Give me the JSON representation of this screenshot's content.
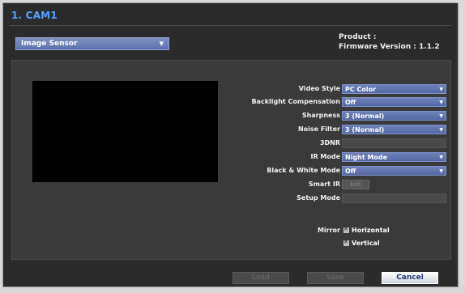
{
  "window": {
    "title": "1. CAM1"
  },
  "section_select": {
    "value": "Image Sensor"
  },
  "info": {
    "product": "Product :",
    "firmware": "Firmware Version : 1.1.2"
  },
  "settings": [
    {
      "label": "Video Style",
      "type": "select",
      "value": "PC Color"
    },
    {
      "label": "Backlight Compensation",
      "type": "select",
      "value": "Off"
    },
    {
      "label": "Sharpness",
      "type": "select",
      "value": "3 (Normal)"
    },
    {
      "label": "Noise Filter",
      "type": "select",
      "value": "3 (Normal)"
    },
    {
      "label": "3DNR",
      "type": "blank",
      "value": ""
    },
    {
      "label": "IR Mode",
      "type": "select",
      "value": "Night Mode"
    },
    {
      "label": "Black & White Mode",
      "type": "select",
      "value": "Off"
    },
    {
      "label": "Smart IR",
      "type": "button",
      "value": "Edit"
    },
    {
      "label": "Setup Mode",
      "type": "blank",
      "value": ""
    }
  ],
  "mirror": {
    "label": "Mirror",
    "horizontal": "Horizontal",
    "vertical": "Vertical"
  },
  "buttons": {
    "load": "Load",
    "save": "Save",
    "cancel": "Cancel"
  }
}
